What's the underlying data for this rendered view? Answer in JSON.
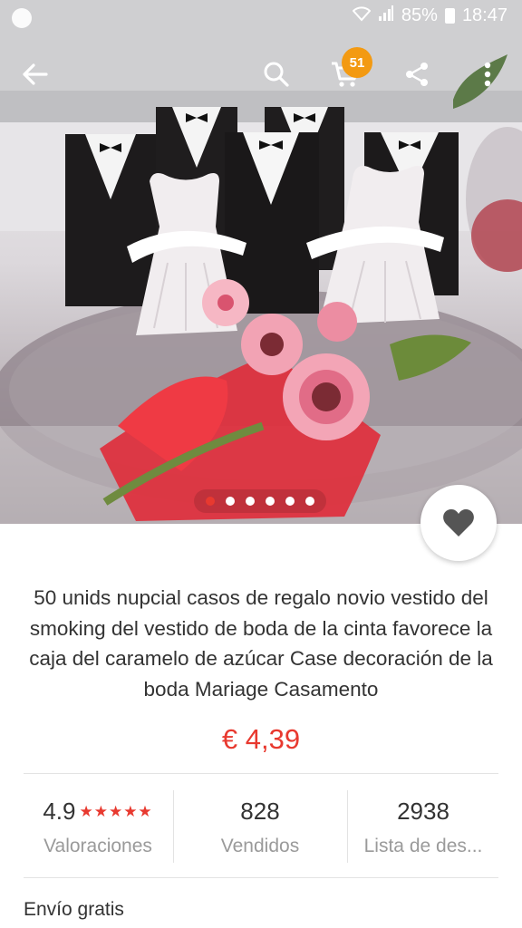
{
  "status_bar": {
    "battery": "85%",
    "time": "18:47"
  },
  "app_bar": {
    "cart_count": "51"
  },
  "gallery": {
    "total_images": 6,
    "active_index": 0
  },
  "product": {
    "title": "50 unids nupcial casos de regalo novio vestido del smoking del vestido de boda de la cinta favorece la caja del caramelo de azúcar Case decoración de la boda Mariage Casamento",
    "price": "€ 4,39"
  },
  "stats": {
    "rating_value": "4.9",
    "rating_stars": "★★★★★",
    "rating_label": "Valoraciones",
    "sold_value": "828",
    "sold_label": "Vendidos",
    "wishlist_value": "2938",
    "wishlist_label": "Lista de des..."
  },
  "shipping": {
    "label": "Envío gratis"
  },
  "colors": {
    "accent": "#e8392f",
    "badge": "#f39a12"
  }
}
